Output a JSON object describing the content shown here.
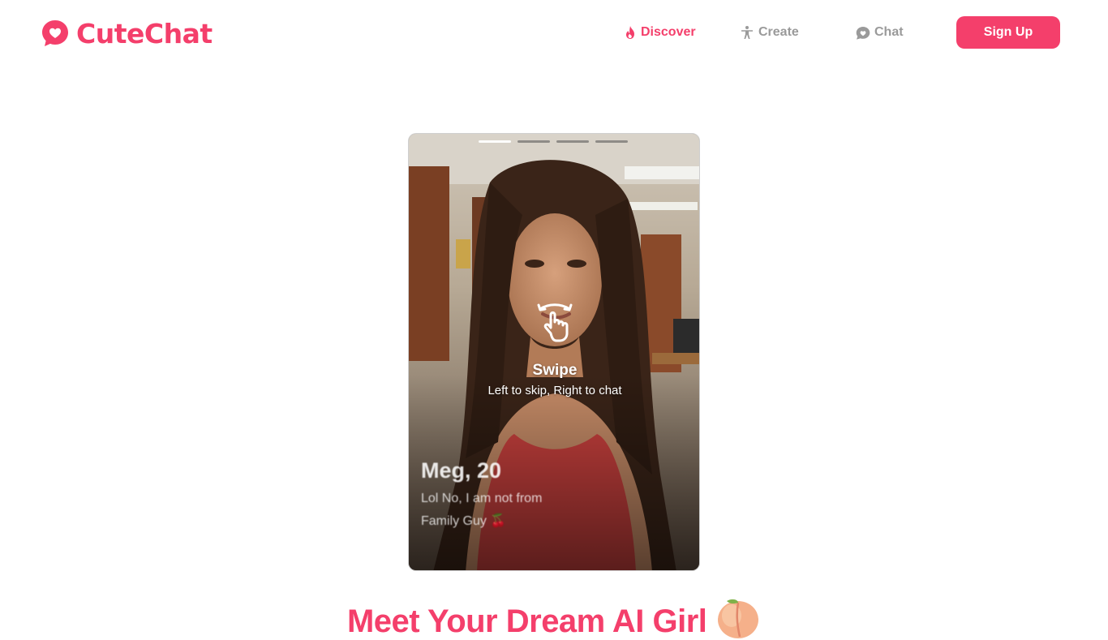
{
  "brand": {
    "name": "CuteChat",
    "accent": "#f43f6b"
  },
  "nav": {
    "items": [
      {
        "label": "Discover",
        "icon": "flame-icon",
        "active": true
      },
      {
        "label": "Create",
        "icon": "person-icon",
        "active": false
      },
      {
        "label": "Chat",
        "icon": "chat-bubble-icon",
        "active": false
      }
    ],
    "signup_label": "Sign Up"
  },
  "card": {
    "photo_count": 4,
    "current_photo": 1,
    "swipe_title": "Swipe",
    "swipe_hint": "Left to skip, Right to chat",
    "profile_name": "Meg, 20",
    "profile_bio": "Lol No, I am not from Family Guy 🍒"
  },
  "hero": {
    "title": "Meet Your Dream AI Girl",
    "emoji": "peach-icon"
  }
}
